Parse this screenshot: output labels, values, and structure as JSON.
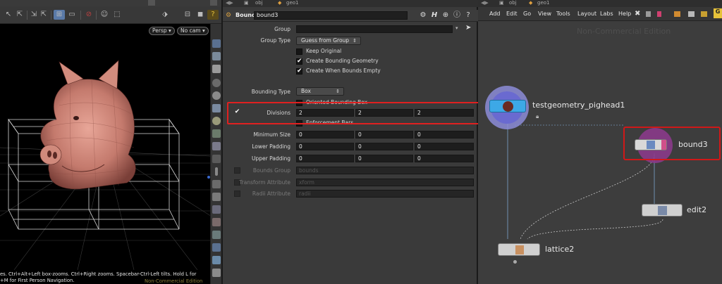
{
  "viewport": {
    "persp_label": "Persp",
    "cam_label": "No cam",
    "hint_line1": "es. Ctrl+Alt+Left box-zooms. Ctrl+Right zooms. Spacebar-Ctrl-Left tilts. Hold L for",
    "hint_line2": "+M for First Person Navigation.",
    "noncommercial": "Non-Commercial Edition"
  },
  "params": {
    "path_obj": "obj",
    "path_geo": "geo1",
    "node_type": "Bound",
    "node_name": "bound3",
    "group_label": "Group",
    "group_value": "",
    "group_type_label": "Group Type",
    "group_type_value": "Guess from Group",
    "keep_original": "Keep Original",
    "create_bounding_geometry": "Create Bounding Geometry",
    "create_when_empty": "Create When Bounds Empty",
    "bounding_type_label": "Bounding Type",
    "bounding_type_value": "Box",
    "oriented_bbox": "Oriented Bounding Box",
    "divisions_label": "Divisions",
    "divisions": [
      "2",
      "2",
      "2"
    ],
    "enforcement_bars": "Enforcement Bars",
    "min_size_label": "Minimum Size",
    "min_size": [
      "0",
      "0",
      "0"
    ],
    "lower_padding_label": "Lower Padding",
    "lower_padding": [
      "0",
      "0",
      "0"
    ],
    "upper_padding_label": "Upper Padding",
    "upper_padding": [
      "0",
      "0",
      "0"
    ],
    "bounds_group_label": "Bounds Group",
    "bounds_group_value": "bounds",
    "transform_attr_label": "Transform Attribute",
    "transform_attr_value": "xform",
    "radii_attr_label": "Radii Attribute",
    "radii_attr_value": "radii"
  },
  "network": {
    "path_obj": "obj",
    "path_geo": "geo1",
    "menu": [
      "Add",
      "Edit",
      "Go",
      "View",
      "Tools",
      "Layout",
      "Labs",
      "Help"
    ],
    "watermark": "Non-Commercial Edition",
    "nodes": {
      "testgeometry": "testgeometry_pighead1",
      "bound": "bound3",
      "edit": "edit2",
      "lattice": "lattice2"
    }
  },
  "colors": {
    "highlight": "#e02020",
    "node_blue": "#3da8e6",
    "node_purple": "#8a3a8a",
    "wire": "#6f8fb0"
  }
}
